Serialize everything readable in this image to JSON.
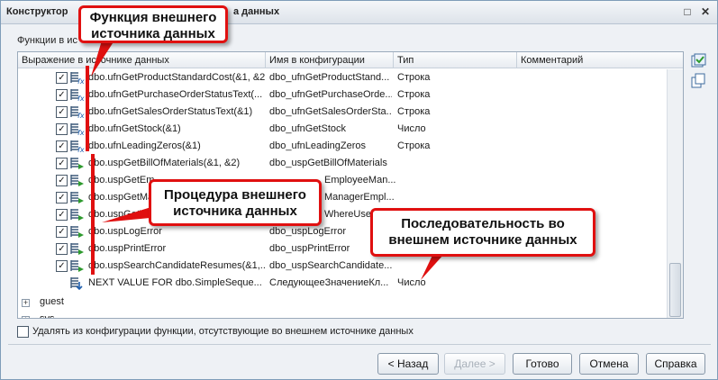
{
  "window": {
    "title_left": "Конструктор",
    "title_right": "а данных",
    "maximize_symbol": "□",
    "close_symbol": "✕"
  },
  "section_label": "Функции в ис",
  "columns": [
    "Выражение в источнике данных",
    "Имя в конфигурации",
    "Тип",
    "Комментарий"
  ],
  "rows": [
    {
      "expr": "dbo.ufnGetProductStandardCost(&1, &2)",
      "name": "dbo_ufnGetProductStand...",
      "type": "Строка",
      "kind": "function"
    },
    {
      "expr": "dbo.ufnGetPurchaseOrderStatusText(...",
      "name": "dbo_ufnGetPurchaseOrde...",
      "type": "Строка",
      "kind": "function"
    },
    {
      "expr": "dbo.ufnGetSalesOrderStatusText(&1)",
      "name": "dbo_ufnGetSalesOrderSta...",
      "type": "Строка",
      "kind": "function"
    },
    {
      "expr": "dbo.ufnGetStock(&1)",
      "name": "dbo_ufnGetStock",
      "type": "Число",
      "kind": "function"
    },
    {
      "expr": "dbo.ufnLeadingZeros(&1)",
      "name": "dbo_ufnLeadingZeros",
      "type": "Строка",
      "kind": "function"
    },
    {
      "expr": "dbo.uspGetBillOfMaterials(&1, &2)",
      "name": "dbo_uspGetBillOfMaterials",
      "type": "",
      "kind": "procedure"
    },
    {
      "expr": "dbo.uspGetEm",
      "name": "EmployeeMan...",
      "type": "",
      "kind": "procedure"
    },
    {
      "expr": "dbo.uspGetMa",
      "name": "ManagerEmpl...",
      "type": "",
      "kind": "procedure"
    },
    {
      "expr": "dbo.uspGetW",
      "name": "WhereUsed...",
      "type": "",
      "kind": "procedure"
    },
    {
      "expr": "dbo.uspLogError",
      "name": "dbo_uspLogError",
      "type": "",
      "kind": "procedure"
    },
    {
      "expr": "dbo.uspPrintError",
      "name": "dbo_uspPrintError",
      "type": "",
      "kind": "procedure"
    },
    {
      "expr": "dbo.uspSearchCandidateResumes(&1,...",
      "name": "dbo_uspSearchCandidate...",
      "type": "",
      "kind": "procedure"
    },
    {
      "expr": "NEXT VALUE FOR dbo.SimpleSeque...",
      "name": "СледующееЗначениеКл...",
      "type": "Число",
      "kind": "sequence"
    }
  ],
  "tree_nodes": [
    "guest",
    "sys"
  ],
  "callouts": {
    "function": "Функция внешнего источника данных",
    "procedure": "Процедура внешнего источника данных",
    "sequence": "Последовательность во внешнем источнике данных"
  },
  "checkbox_label": "Удалять из конфигурации функции, отсутствующие во внешнем источнике данных",
  "buttons": {
    "back": "< Назад",
    "next": "Далее >",
    "done": "Готово",
    "cancel": "Отмена",
    "help": "Справка"
  },
  "colors": {
    "callout_border": "#e01010",
    "function_icon": "#1f5fae",
    "procedure_icon": "#2e9a2e",
    "sequence_icon": "#1f5fae"
  },
  "icons": {
    "function": "function-icon",
    "procedure": "procedure-icon",
    "sequence": "sequence-icon",
    "side_top": "check-all-icon",
    "side_bottom": "copy-icon"
  }
}
